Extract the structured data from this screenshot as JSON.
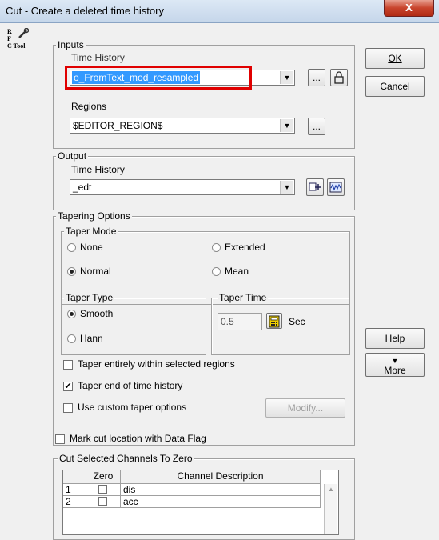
{
  "window": {
    "title": "Cut - Create a deleted time history",
    "close_glyph": "X"
  },
  "rfc": {
    "line1": "R",
    "line2": "F",
    "line3": "C Tool"
  },
  "inputs": {
    "legend": "Inputs",
    "time_history_label": "Time History",
    "time_history_value": "o_FromText_mod_resampled",
    "regions_label": "Regions",
    "regions_value": "$EDITOR_REGION$",
    "ellipsis": "..."
  },
  "output": {
    "legend": "Output",
    "time_history_label": "Time History",
    "time_history_value": "_edt"
  },
  "tapering": {
    "legend": "Tapering Options",
    "taper_mode_legend": "Taper Mode",
    "modes": {
      "none": "None",
      "extended": "Extended",
      "normal": "Normal",
      "mean": "Mean"
    },
    "taper_type_legend": "Taper Type",
    "types": {
      "smooth": "Smooth",
      "hann": "Hann"
    },
    "taper_time_legend": "Taper Time",
    "taper_time_value": "0.5",
    "taper_time_unit": "Sec",
    "check_within_regions": "Taper entirely within selected regions",
    "check_end_of_history": "Taper end of time history",
    "check_custom": "Use custom taper options",
    "modify_label": "Modify..."
  },
  "mark_cut": "Mark cut location with Data Flag",
  "cut_channels": {
    "legend": "Cut Selected Channels To Zero",
    "columns": [
      "Zero",
      "Channel Description"
    ],
    "rows": [
      {
        "num": "1",
        "desc": "dis"
      },
      {
        "num": "2",
        "desc": "acc"
      }
    ]
  },
  "buttons": {
    "ok": "OK",
    "cancel": "Cancel",
    "help": "Help",
    "more": "More",
    "more_arrow": "▼"
  },
  "colors": {
    "highlight": "#e00000",
    "selection": "#3399ff"
  }
}
